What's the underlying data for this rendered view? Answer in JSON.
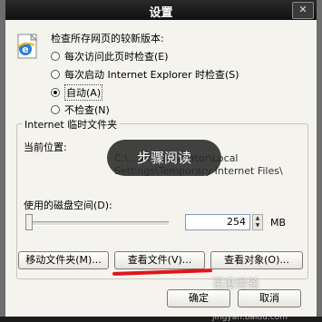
{
  "window": {
    "title": "设置",
    "close_glyph": "✕"
  },
  "check_section": {
    "label": "检查所存网页的较新版本:",
    "options": [
      {
        "label": "每次访问此页时检查(E)",
        "selected": false
      },
      {
        "label": "每次启动 Internet Explorer 时检查(S)",
        "selected": false
      },
      {
        "label": "自动(A)",
        "selected": true
      },
      {
        "label": "不检查(N)",
        "selected": false
      }
    ]
  },
  "temp_files": {
    "group_title": "Internet 临时文件夹",
    "location_label": "当前位置:",
    "location_value": "C:\\...\\Administrator\\Local Settings\\Temporary Internet Files\\",
    "disk_space_label": "使用的磁盘空间(D):",
    "disk_space_value": "254",
    "disk_space_unit": "MB",
    "slider_fraction": 0.0
  },
  "buttons": {
    "move_folder": "移动文件夹(M)...",
    "view_files": "查看文件(V)...",
    "view_objects": "查看对象(O)...",
    "ok": "确定",
    "cancel": "取消"
  },
  "overlay_text": "步骤阅读",
  "watermark": {
    "text": "百度经验",
    "url": "jingyan.baidu.com"
  },
  "colors": {
    "title_bar": "#1a1a1a",
    "dialog_bg": "#f4f3ee",
    "red_mark": "#e0151b"
  }
}
